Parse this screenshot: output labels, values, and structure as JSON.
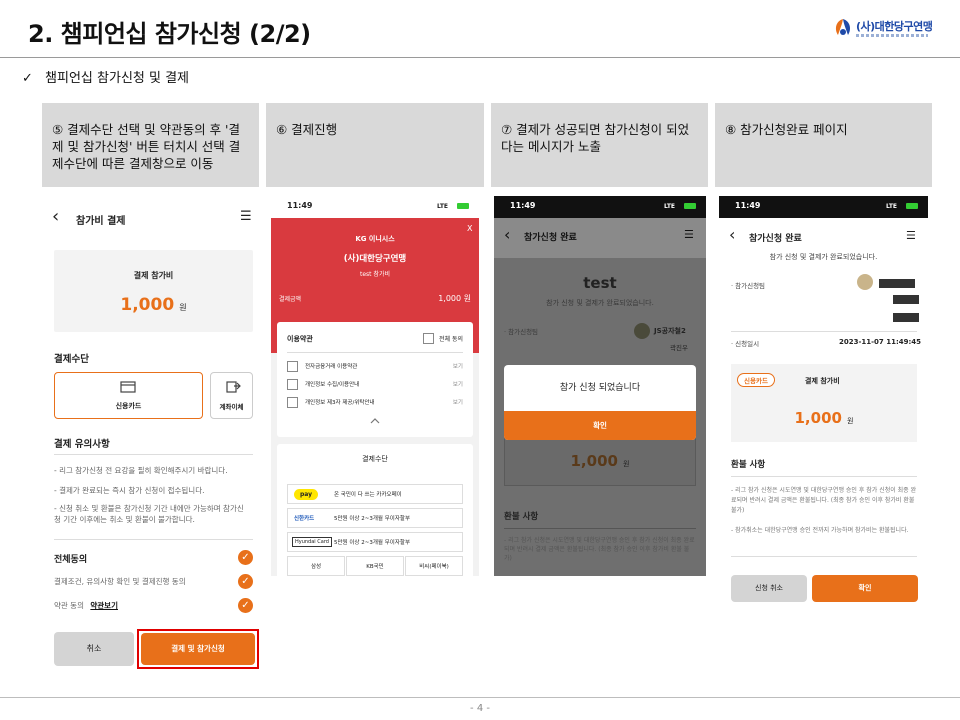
{
  "slide": {
    "title": "2. 챔피언십 참가신청 (2/2)",
    "subtitle": "챔피언십 참가신청 및 결제",
    "check_mark": "✓",
    "page_number": "- 4 -",
    "logo_text": "(사)대한당구연맹"
  },
  "steps": [
    {
      "text": "⑤ 결제수단 선택 및 약관동의 후 '결제 및 참가신청' 버튼 터치시 선택 결제수단에 따른 결제창으로 이동"
    },
    {
      "text": "⑥ 결제진행"
    },
    {
      "text": "⑦ 결제가 성공되면 참가신청이 되었다는 메시지가 노출"
    },
    {
      "text": "⑧ 참가신청완료 페이지"
    }
  ],
  "screen1": {
    "back": "‹",
    "header_title": "참가비 결제",
    "menu": "☰",
    "fee_label": "결제 참가비",
    "fee_amount": "1,000",
    "fee_unit": "원",
    "method_title": "결제수단",
    "method_card": "신용카드",
    "method_transfer": "계좌이체",
    "notice_title": "결제 유의사항",
    "notice_1": "- 리그 참가신청 전 요강을 필히 확인해주시기 바랍니다.",
    "notice_2": "- 결제가 완료되는 즉시 참가 신청이 접수됩니다.",
    "notice_3": "- 신청 취소 및 환불은 참가신청 기간 내에만 가능하며 참가신청 기간 이후에는 취소 및 환불이 불가합니다.",
    "agree_all": "전체동의",
    "agree_terms": "결제조건, 유의사항 확인 및 결제진행 동의",
    "agree_policy": "약관 동의",
    "agree_policy_link": "약관보기",
    "cancel": "취소",
    "submit": "결제 및 참가신청"
  },
  "screen2": {
    "time": "11:49",
    "signal": "LTE",
    "pg_name": "KG 이니시스",
    "close": "X",
    "merchant": "(사)대한당구연맹",
    "product": "test 참가비",
    "amount_label": "결제금액",
    "amount": "1,000 원",
    "terms_title": "이용약관",
    "terms_all": "전체 동의",
    "terms": [
      {
        "label": "전자금융거래 이용약관",
        "view": "보기"
      },
      {
        "label": "개인정보 수집/이용안내",
        "view": "보기"
      },
      {
        "label": "개인정보 제3자 제공/위탁안내",
        "view": "보기"
      }
    ],
    "method_title": "결제수단",
    "pay_text": "온 국민이 다 쓰는 카카오페이",
    "pay_badge": "pay",
    "shinhan": "신한카드",
    "shinhan_text": "5만원 이상 2~3개월 무이자할부",
    "hyundai": "Hyundai Card",
    "hyundai_text": "5만원 이상 2~3개월 무이자할부",
    "banks": [
      "삼성",
      "KB국민",
      "비씨(페이북)"
    ]
  },
  "screen3": {
    "time": "11:49",
    "signal": "LTE",
    "header_title": "참가신청 완료",
    "event_title": "test",
    "done_msg": "참가 신청 및 결제가 완료되었습니다.",
    "team_label": "· 참가신청팀",
    "team_name": "JS공자철2",
    "team_sub": "곽진우",
    "modal_msg": "참가 신청 되었습니다",
    "modal_ok": "확인",
    "amount": "1,000",
    "unit": "원",
    "refund_title": "환불 사항",
    "refund_text": "- 리그 참가 신청은 시도연맹 및 대한당구연맹 승인 후 참가 신청이 최종 완료되며 반려시 결제 금액은 환불됩니다. (최종 참가 승인 이후 참가비 환불 불가)"
  },
  "screen4": {
    "time": "11:49",
    "signal": "LTE",
    "header_title": "참가신청 완료",
    "done_msg": "참가 신청 및 결제가 완료되었습니다.",
    "team_label": "· 참가신청팀",
    "date_label": "· 신청일시",
    "date_value": "2023-11-07 11:49:45",
    "card_badge": "신용카드",
    "fee_label": "결제 참가비",
    "amount": "1,000",
    "unit": "원",
    "refund_title": "환불 사항",
    "refund_1": "- 리그 참가 신청은 시도연맹 및 대한당구연맹 승인 후 참가 신청이 최종 완료되며 반려시 결제 금액은 환불됩니다. (최종 참가 승인 이후 참가비 환불 불가)",
    "refund_2": "- 참가취소는 대한당구연맹 승인 전까지 가능하며 참가비는 환불됩니다.",
    "cancel": "신청 취소",
    "ok": "확인"
  },
  "colors": {
    "accent": "#e8701a",
    "pg_red": "#d93a3f",
    "highlight": "#e00000",
    "step_bg": "#d9d9d9"
  }
}
